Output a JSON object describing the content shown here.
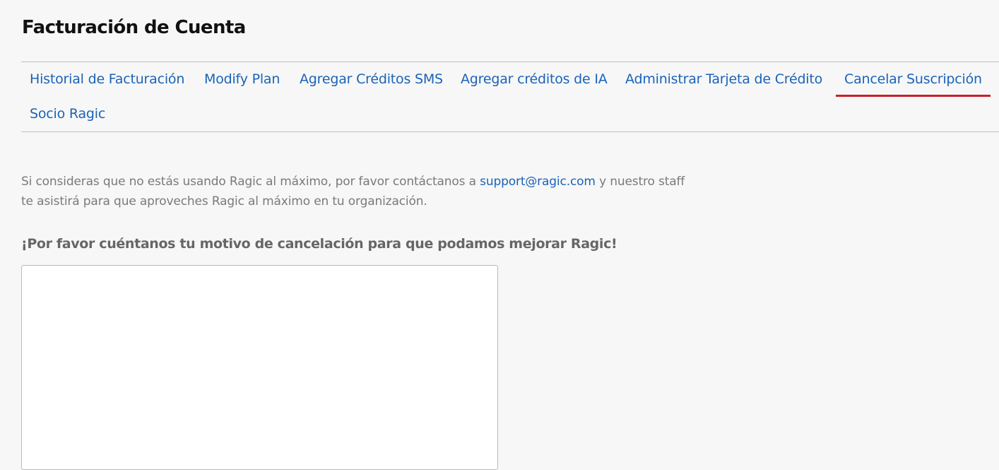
{
  "page": {
    "title": "Facturación de Cuenta"
  },
  "tabs": [
    {
      "label": "Historial de Facturación",
      "active": false
    },
    {
      "label": "Modify Plan",
      "active": false
    },
    {
      "label": "Agregar Créditos SMS",
      "active": false
    },
    {
      "label": "Agregar créditos de IA",
      "active": false
    },
    {
      "label": "Administrar Tarjeta de Crédito",
      "active": false
    },
    {
      "label": "Cancelar Suscripción",
      "active": true
    },
    {
      "label": "Socio Ragic",
      "active": false
    }
  ],
  "cancel": {
    "info_before": "Si consideras que no estás usando Ragic al máximo, por favor contáctanos a ",
    "support_email": "support@ragic.com",
    "info_after": " y nuestro staff te asistirá para que aproveches Ragic al máximo en tu organización.",
    "reason_heading": "¡Por favor cuéntanos tu motivo de cancelación para que podamos mejorar Ragic!",
    "reason_value": "",
    "reason_placeholder": ""
  },
  "colors": {
    "link": "#1a63b8",
    "active_tab_underline": "#c62127",
    "background": "#f7f7f7",
    "divider": "#bdbdbd",
    "muted_text": "#7a7a7a"
  }
}
